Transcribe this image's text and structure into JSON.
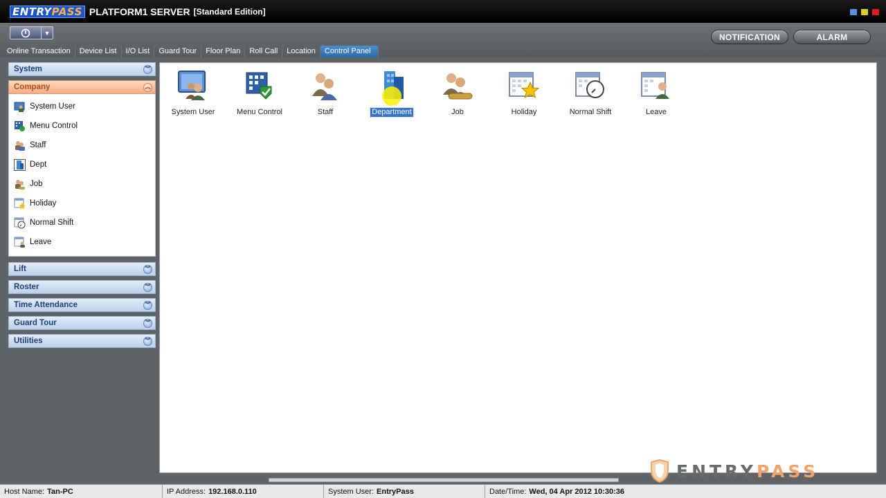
{
  "window": {
    "brand_entry": "ENTRY",
    "brand_pass": "PASS",
    "title": "PLATFORM1 SERVER",
    "edition": "[Standard Edition]",
    "controls": [
      "minimize",
      "maximize",
      "close"
    ]
  },
  "toolbar": {
    "power_icon": "power-icon",
    "notification_label": "NOTIFICATION",
    "alarm_label": "ALARM"
  },
  "tabs": [
    {
      "label": "Online Transaction"
    },
    {
      "label": "Device List"
    },
    {
      "label": "I/O List"
    },
    {
      "label": "Guard Tour"
    },
    {
      "label": "Floor Plan"
    },
    {
      "label": "Roll Call"
    },
    {
      "label": "Location"
    },
    {
      "label": "Control Panel",
      "active": true
    }
  ],
  "sidebar": {
    "groups": [
      {
        "label": "System"
      },
      {
        "label": "Company",
        "open": true,
        "items": [
          {
            "label": "System User"
          },
          {
            "label": "Menu Control"
          },
          {
            "label": "Staff"
          },
          {
            "label": "Dept"
          },
          {
            "label": "Job"
          },
          {
            "label": "Holiday"
          },
          {
            "label": "Normal Shift"
          },
          {
            "label": "Leave"
          }
        ]
      },
      {
        "label": "Lift"
      },
      {
        "label": "Roster"
      },
      {
        "label": "Time Attendance"
      },
      {
        "label": "Guard Tour"
      },
      {
        "label": "Utilities"
      }
    ]
  },
  "panel": {
    "items": [
      {
        "label": "System User",
        "icon": "system-user-icon"
      },
      {
        "label": "Menu Control",
        "icon": "menu-control-icon"
      },
      {
        "label": "Staff",
        "icon": "staff-icon"
      },
      {
        "label": "Department",
        "icon": "department-icon",
        "selected": true
      },
      {
        "label": "Job",
        "icon": "job-icon"
      },
      {
        "label": "Holiday",
        "icon": "holiday-icon"
      },
      {
        "label": "Normal Shift",
        "icon": "normal-shift-icon"
      },
      {
        "label": "Leave",
        "icon": "leave-icon"
      }
    ]
  },
  "status": {
    "host_label": "Host Name:",
    "host_value": "Tan-PC",
    "ip_label": "IP Address:",
    "ip_value": "192.168.0.110",
    "user_label": "System User:",
    "user_value": "EntryPass",
    "datetime_label": "Date/Time:",
    "datetime_value": "Wed, 04 Apr 2012 10:30:36"
  },
  "watermark": {
    "part1": "ENTRY",
    "part2": "PASS"
  },
  "colors": {
    "accent_blue": "#3574c9",
    "open_group": "#b34a12",
    "brand_orange": "#ffb14a"
  }
}
